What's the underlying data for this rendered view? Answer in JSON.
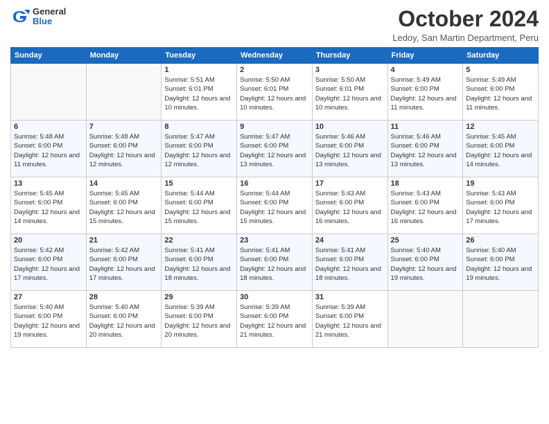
{
  "header": {
    "logo_general": "General",
    "logo_blue": "Blue",
    "month_title": "October 2024",
    "location": "Ledoy, San Martin Department, Peru"
  },
  "days_of_week": [
    "Sunday",
    "Monday",
    "Tuesday",
    "Wednesday",
    "Thursday",
    "Friday",
    "Saturday"
  ],
  "weeks": [
    [
      {
        "day": "",
        "info": ""
      },
      {
        "day": "",
        "info": ""
      },
      {
        "day": "1",
        "info": "Sunrise: 5:51 AM\nSunset: 6:01 PM\nDaylight: 12 hours and 10 minutes."
      },
      {
        "day": "2",
        "info": "Sunrise: 5:50 AM\nSunset: 6:01 PM\nDaylight: 12 hours and 10 minutes."
      },
      {
        "day": "3",
        "info": "Sunrise: 5:50 AM\nSunset: 6:01 PM\nDaylight: 12 hours and 10 minutes."
      },
      {
        "day": "4",
        "info": "Sunrise: 5:49 AM\nSunset: 6:00 PM\nDaylight: 12 hours and 11 minutes."
      },
      {
        "day": "5",
        "info": "Sunrise: 5:49 AM\nSunset: 6:00 PM\nDaylight: 12 hours and 11 minutes."
      }
    ],
    [
      {
        "day": "6",
        "info": "Sunrise: 5:48 AM\nSunset: 6:00 PM\nDaylight: 12 hours and 11 minutes."
      },
      {
        "day": "7",
        "info": "Sunrise: 5:48 AM\nSunset: 6:00 PM\nDaylight: 12 hours and 12 minutes."
      },
      {
        "day": "8",
        "info": "Sunrise: 5:47 AM\nSunset: 6:00 PM\nDaylight: 12 hours and 12 minutes."
      },
      {
        "day": "9",
        "info": "Sunrise: 5:47 AM\nSunset: 6:00 PM\nDaylight: 12 hours and 13 minutes."
      },
      {
        "day": "10",
        "info": "Sunrise: 5:46 AM\nSunset: 6:00 PM\nDaylight: 12 hours and 13 minutes."
      },
      {
        "day": "11",
        "info": "Sunrise: 5:46 AM\nSunset: 6:00 PM\nDaylight: 12 hours and 13 minutes."
      },
      {
        "day": "12",
        "info": "Sunrise: 5:45 AM\nSunset: 6:00 PM\nDaylight: 12 hours and 14 minutes."
      }
    ],
    [
      {
        "day": "13",
        "info": "Sunrise: 5:45 AM\nSunset: 6:00 PM\nDaylight: 12 hours and 14 minutes."
      },
      {
        "day": "14",
        "info": "Sunrise: 5:45 AM\nSunset: 6:00 PM\nDaylight: 12 hours and 15 minutes."
      },
      {
        "day": "15",
        "info": "Sunrise: 5:44 AM\nSunset: 6:00 PM\nDaylight: 12 hours and 15 minutes."
      },
      {
        "day": "16",
        "info": "Sunrise: 5:44 AM\nSunset: 6:00 PM\nDaylight: 12 hours and 15 minutes."
      },
      {
        "day": "17",
        "info": "Sunrise: 5:43 AM\nSunset: 6:00 PM\nDaylight: 12 hours and 16 minutes."
      },
      {
        "day": "18",
        "info": "Sunrise: 5:43 AM\nSunset: 6:00 PM\nDaylight: 12 hours and 16 minutes."
      },
      {
        "day": "19",
        "info": "Sunrise: 5:43 AM\nSunset: 6:00 PM\nDaylight: 12 hours and 17 minutes."
      }
    ],
    [
      {
        "day": "20",
        "info": "Sunrise: 5:42 AM\nSunset: 6:00 PM\nDaylight: 12 hours and 17 minutes."
      },
      {
        "day": "21",
        "info": "Sunrise: 5:42 AM\nSunset: 6:00 PM\nDaylight: 12 hours and 17 minutes."
      },
      {
        "day": "22",
        "info": "Sunrise: 5:41 AM\nSunset: 6:00 PM\nDaylight: 12 hours and 18 minutes."
      },
      {
        "day": "23",
        "info": "Sunrise: 5:41 AM\nSunset: 6:00 PM\nDaylight: 12 hours and 18 minutes."
      },
      {
        "day": "24",
        "info": "Sunrise: 5:41 AM\nSunset: 6:00 PM\nDaylight: 12 hours and 18 minutes."
      },
      {
        "day": "25",
        "info": "Sunrise: 5:40 AM\nSunset: 6:00 PM\nDaylight: 12 hours and 19 minutes."
      },
      {
        "day": "26",
        "info": "Sunrise: 5:40 AM\nSunset: 6:00 PM\nDaylight: 12 hours and 19 minutes."
      }
    ],
    [
      {
        "day": "27",
        "info": "Sunrise: 5:40 AM\nSunset: 6:00 PM\nDaylight: 12 hours and 19 minutes."
      },
      {
        "day": "28",
        "info": "Sunrise: 5:40 AM\nSunset: 6:00 PM\nDaylight: 12 hours and 20 minutes."
      },
      {
        "day": "29",
        "info": "Sunrise: 5:39 AM\nSunset: 6:00 PM\nDaylight: 12 hours and 20 minutes."
      },
      {
        "day": "30",
        "info": "Sunrise: 5:39 AM\nSunset: 6:00 PM\nDaylight: 12 hours and 21 minutes."
      },
      {
        "day": "31",
        "info": "Sunrise: 5:39 AM\nSunset: 6:00 PM\nDaylight: 12 hours and 21 minutes."
      },
      {
        "day": "",
        "info": ""
      },
      {
        "day": "",
        "info": ""
      }
    ]
  ]
}
